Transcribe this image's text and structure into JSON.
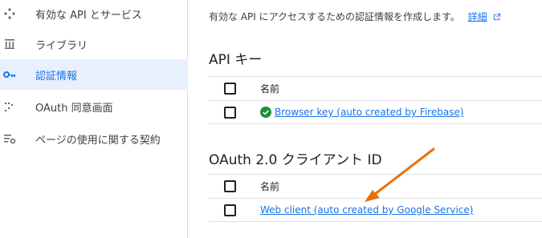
{
  "sidebar": {
    "items": [
      {
        "label": "有効な API とサービス",
        "icon": "services-icon",
        "active": false
      },
      {
        "label": "ライブラリ",
        "icon": "library-icon",
        "active": false
      },
      {
        "label": "認証情報",
        "icon": "key-icon",
        "active": true
      },
      {
        "label": "OAuth 同意画面",
        "icon": "consent-icon",
        "active": false
      },
      {
        "label": "ページの使用に関する契約",
        "icon": "agreements-icon",
        "active": false
      }
    ]
  },
  "main": {
    "intro_text": "有効な API にアクセスするための認証情報を作成します。",
    "intro_link": "詳細",
    "api_keys": {
      "title": "API キー",
      "column_name": "名前",
      "rows": [
        {
          "name": "Browser key (auto created by Firebase)",
          "status": "ok"
        }
      ]
    },
    "oauth_clients": {
      "title": "OAuth 2.0 クライアント ID",
      "column_name": "名前",
      "rows": [
        {
          "name": "Web client (auto created by Google Service)"
        }
      ]
    }
  },
  "colors": {
    "accent": "#1a73e8",
    "active_bg": "#e8f0fe",
    "status_ok": "#1e8e3e",
    "annotation_arrow": "#e8710a"
  }
}
